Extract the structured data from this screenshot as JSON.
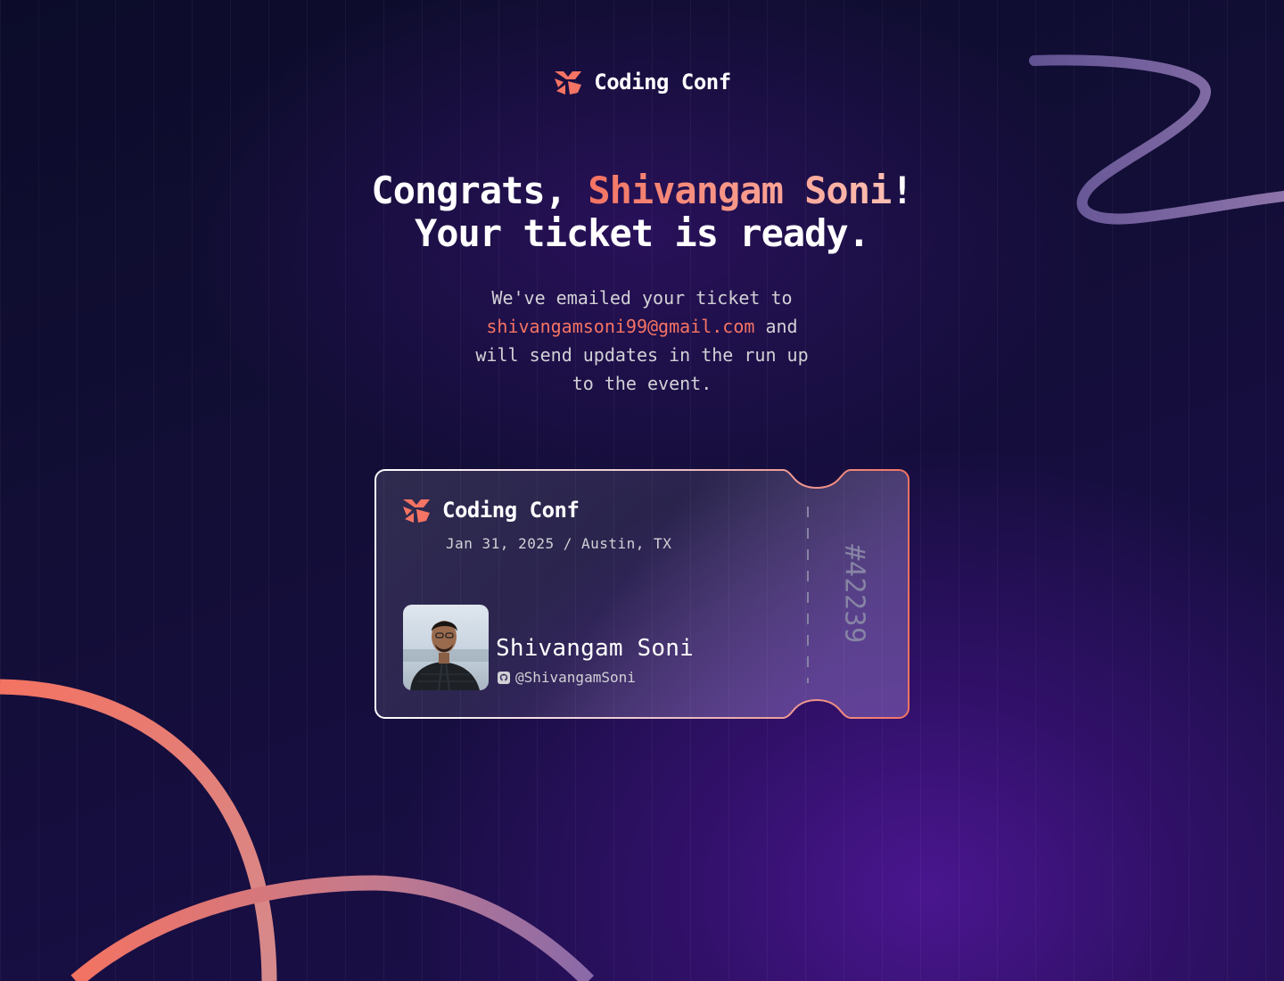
{
  "app": {
    "name": "Coding Conf",
    "logo_icon": "coding-conf-logo-icon",
    "accent_color": "#f57463",
    "gradient_colors": [
      "#f37362",
      "#ffbfb2"
    ]
  },
  "headline": {
    "prefix": "Congrats, ",
    "name": "Shivangam Soni",
    "suffix": "!",
    "line2": "Your ticket is ready."
  },
  "message": {
    "part1": "We've emailed your ticket to ",
    "email": "shivangamsoni99@gmail.com",
    "part2": " and will send updates in the run up to the event."
  },
  "ticket": {
    "brand": "Coding Conf",
    "date_location": "Jan 31, 2025 / Austin, TX",
    "attendee_name": "Shivangam Soni",
    "github_icon": "github-icon",
    "github_username": "@ShivangamSoni",
    "ticket_number": "#42239"
  }
}
